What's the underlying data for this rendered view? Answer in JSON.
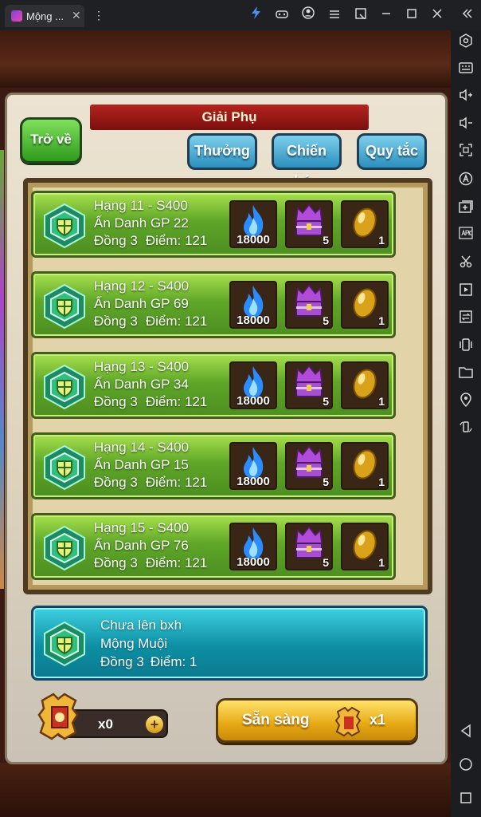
{
  "window": {
    "tab_title": "Mộng ...",
    "tab_close": "✕",
    "menu_dots": "⋮"
  },
  "titlebar_icons": [
    "bolt-icon",
    "gamepad-icon",
    "account-icon",
    "menu-icon",
    "expand-icon",
    "minimize-icon",
    "maximize-icon",
    "close-icon",
    "collapse-sidebar-icon"
  ],
  "sidebar_icons": [
    "settings-icon",
    "keyboard-icon",
    "volume-up-icon",
    "volume-down-icon",
    "screenshot-icon",
    "macro-icon",
    "add-window-icon",
    "apk-icon",
    "cut-icon",
    "record-icon",
    "sync-icon",
    "shake-icon",
    "folder-icon",
    "location-icon",
    "rotate-icon",
    "back-icon",
    "home-icon",
    "recents-icon"
  ],
  "game": {
    "title": "Giải Phụ",
    "back_button": "Trở về",
    "buttons": {
      "rewards": "Thưởng",
      "battle_report": "Chiến báo",
      "rules": "Quy tắc"
    },
    "rows": [
      {
        "rank": "Hạng 11 - S400",
        "name": "Ấn Danh GP 22",
        "tier": "Đồng 3",
        "points": "Điểm: 121",
        "reward_fire": "18000",
        "reward_chest": "5",
        "reward_egg": "1"
      },
      {
        "rank": "Hạng 12 - S400",
        "name": "Ấn Danh GP 69",
        "tier": "Đồng 3",
        "points": "Điểm: 121",
        "reward_fire": "18000",
        "reward_chest": "5",
        "reward_egg": "1"
      },
      {
        "rank": "Hạng 13 - S400",
        "name": "Ấn Danh GP 34",
        "tier": "Đồng 3",
        "points": "Điểm: 121",
        "reward_fire": "18000",
        "reward_chest": "5",
        "reward_egg": "1"
      },
      {
        "rank": "Hạng 14 - S400",
        "name": "Ấn Danh GP 15",
        "tier": "Đồng 3",
        "points": "Điểm: 121",
        "reward_fire": "18000",
        "reward_chest": "5",
        "reward_egg": "1"
      },
      {
        "rank": "Hạng 15 - S400",
        "name": "Ấn Danh GP 76",
        "tier": "Đồng 3",
        "points": "Điểm: 121",
        "reward_fire": "18000",
        "reward_chest": "5",
        "reward_egg": "1"
      }
    ],
    "self": {
      "status": "Chưa lên bxh",
      "name": "Mộng Muội",
      "tier": "Đồng 3",
      "points": "Điểm: 1"
    },
    "ticket_count": "x0",
    "plus": "+",
    "ready_button": "Sẵn sàng",
    "ready_cost": "x1"
  },
  "colors": {
    "row_green": "#5fa628",
    "self_teal": "#0d8fa3",
    "ready_gold": "#e6a814",
    "button_blue": "#2b8fbd"
  }
}
